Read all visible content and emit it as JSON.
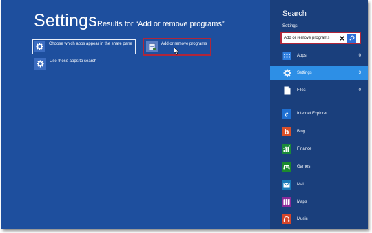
{
  "main": {
    "title": "Settings",
    "subtitle": "Results for “Add or remove programs”",
    "results": [
      {
        "label": "Choose which apps appear in the share pane",
        "icon": "gear-icon",
        "selected": true
      },
      {
        "label": "Use these apps to search",
        "icon": "gear-icon",
        "selected": false
      },
      {
        "label": "Add or remove programs",
        "icon": "programs-icon",
        "highlighted": true
      }
    ]
  },
  "search_pane": {
    "title": "Search",
    "scope_label": "Settings",
    "input_value": "Add or remove programs",
    "scopes": [
      {
        "label": "Apps",
        "count": "0",
        "icon": "apps-grid-icon",
        "selected": false
      },
      {
        "label": "Settings",
        "count": "3",
        "icon": "gear-icon",
        "selected": true
      },
      {
        "label": "Files",
        "count": "0",
        "icon": "file-icon",
        "selected": false
      }
    ],
    "apps": [
      {
        "label": "Internet Explorer",
        "icon": "internet-explorer-icon",
        "color": "#1f6fd1"
      },
      {
        "label": "Bing",
        "icon": "bing-icon",
        "color": "#d9502a"
      },
      {
        "label": "Finance",
        "icon": "finance-icon",
        "color": "#1a8a3a"
      },
      {
        "label": "Games",
        "icon": "games-icon",
        "color": "#1c8a2e"
      },
      {
        "label": "Mail",
        "icon": "mail-icon",
        "color": "#1a7bb8"
      },
      {
        "label": "Maps",
        "icon": "maps-icon",
        "color": "#8a2b9a"
      },
      {
        "label": "Music",
        "icon": "music-icon",
        "color": "#d5452a"
      }
    ]
  },
  "colors": {
    "main_bg": "#1e4f9e",
    "pane_bg": "#1a3f7c",
    "selected_scope": "#2d8fe6",
    "highlight_border": "#b0263a"
  }
}
